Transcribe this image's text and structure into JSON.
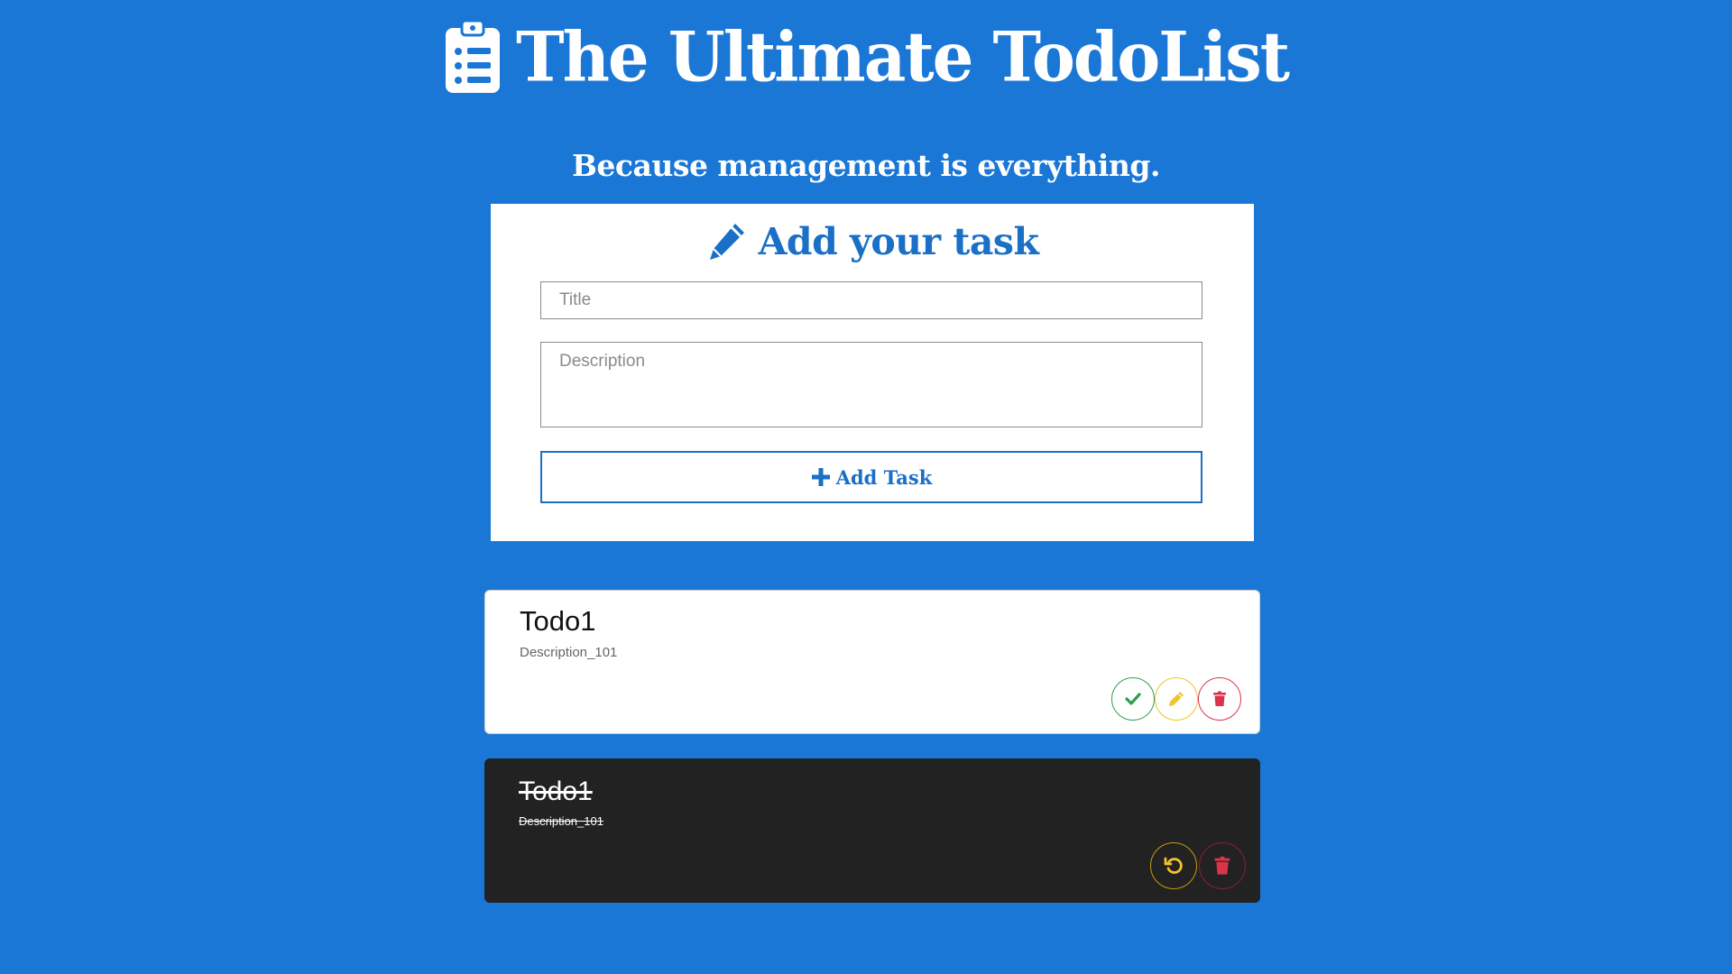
{
  "header": {
    "title": "The Ultimate TodoList",
    "subtitle": "Because management is everything.",
    "logo_icon": "clipboard-list-icon"
  },
  "form": {
    "heading": "Add your task",
    "heading_icon": "pencil-icon",
    "title_placeholder": "Title",
    "title_value": "",
    "description_placeholder": "Description",
    "description_value": "",
    "add_button_label": "Add Task",
    "add_button_icon": "plus-icon"
  },
  "todos": [
    {
      "title": "Todo1",
      "description": "Description_101",
      "completed": false,
      "actions": [
        "check-icon",
        "pencil-icon",
        "trash-icon"
      ]
    },
    {
      "title": "Todo1",
      "description": "Description_101",
      "completed": true,
      "actions": [
        "undo-icon",
        "trash-icon"
      ]
    }
  ],
  "colors": {
    "background": "#1a77d6",
    "accent": "#1a6fc7",
    "complete": "#2e9e52",
    "edit": "#f2c32a",
    "delete": "#d9344a",
    "done_card": "#222222"
  }
}
